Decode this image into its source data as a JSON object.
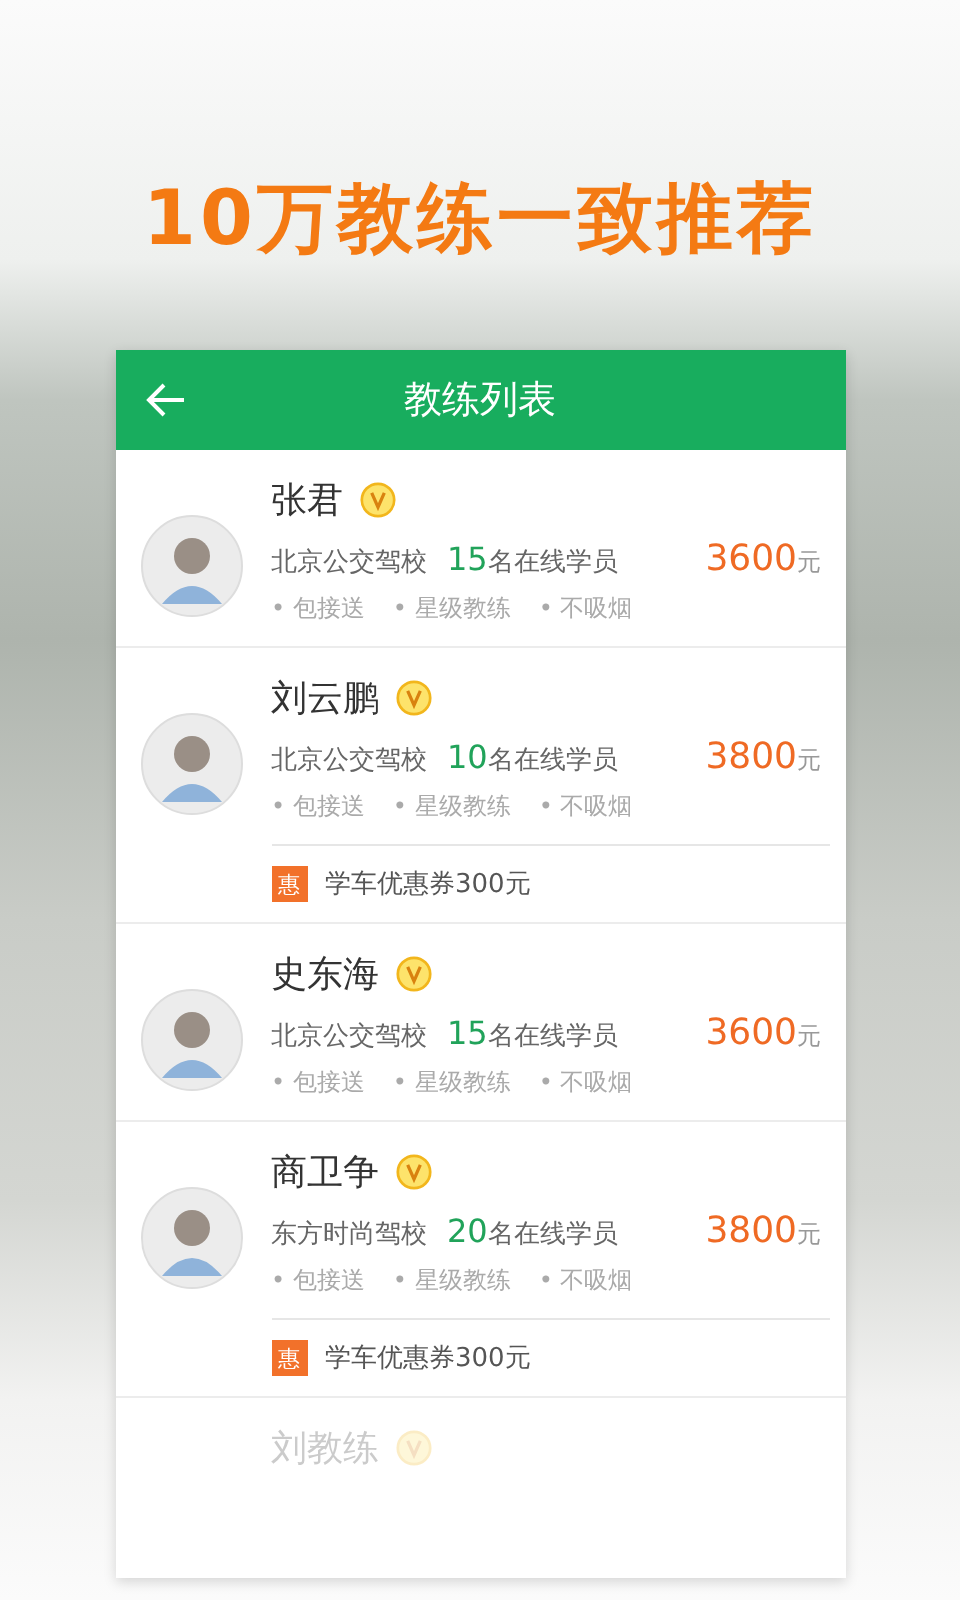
{
  "headline": "10万教练一致推荐",
  "header": {
    "title": "教练列表"
  },
  "coaches": [
    {
      "name": "张君",
      "verified": true,
      "school": "北京公交驾校",
      "count": "15",
      "count_suffix": "名在线学员",
      "price": "3600",
      "unit": "元",
      "tags": [
        "• 包接送",
        "• 星级教练",
        "• 不吸烟"
      ],
      "faded": false
    },
    {
      "name": "刘云鹏",
      "verified": true,
      "school": "北京公交驾校",
      "count": "10",
      "count_suffix": "名在线学员",
      "price": "3800",
      "unit": "元",
      "tags": [
        "• 包接送",
        "• 星级教练",
        "• 不吸烟"
      ],
      "coupon": {
        "badge": "惠",
        "text": "学车优惠券300元"
      },
      "faded": false
    },
    {
      "name": "史东海",
      "verified": true,
      "school": "北京公交驾校",
      "count": "15",
      "count_suffix": "名在线学员",
      "price": "3600",
      "unit": "元",
      "tags": [
        "• 包接送",
        "• 星级教练",
        "• 不吸烟"
      ],
      "faded": false
    },
    {
      "name": "商卫争",
      "verified": true,
      "school": "东方时尚驾校",
      "count": "20",
      "count_suffix": "名在线学员",
      "price": "3800",
      "unit": "元",
      "tags": [
        "• 包接送",
        "• 星级教练",
        "• 不吸烟"
      ],
      "coupon": {
        "badge": "惠",
        "text": "学车优惠券300元"
      },
      "faded": false
    },
    {
      "name": "刘教练",
      "verified": true,
      "faded": true
    }
  ]
}
